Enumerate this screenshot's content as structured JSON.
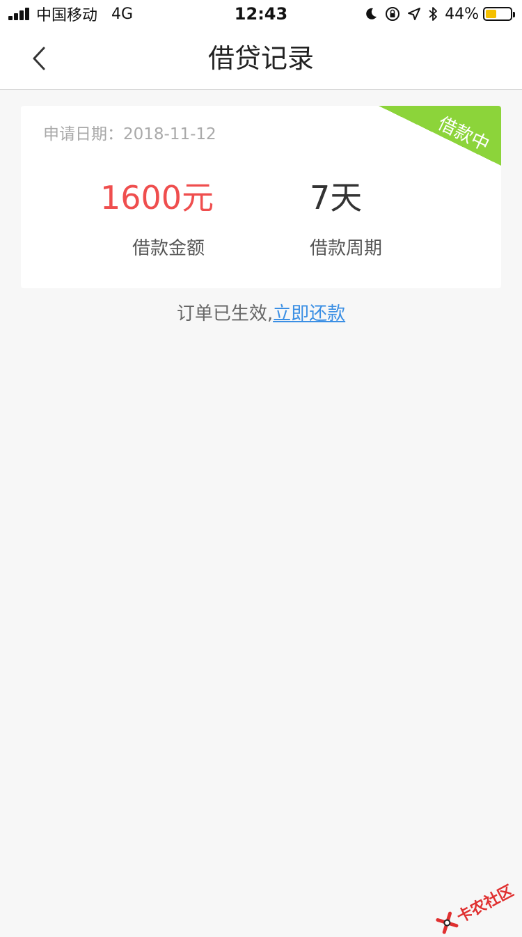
{
  "status_bar": {
    "carrier": "中国移动",
    "network": "4G",
    "time": "12:43",
    "battery_percent": "44%",
    "battery_level": 0.44,
    "battery_color": "#f5c000",
    "icons": [
      "moon-icon",
      "orientation-lock-icon",
      "location-icon",
      "bluetooth-icon"
    ]
  },
  "header": {
    "title": "借贷记录",
    "back_icon": "chevron-left-icon"
  },
  "loan_card": {
    "apply_date": "申请日期：2018-11-12",
    "status_badge": "借款中",
    "status_color": "#8cd43a",
    "amount_value": "1600元",
    "amount_color": "#ef4e4e",
    "amount_label": "借款金额",
    "period_value": "7天",
    "period_label": "借款周期"
  },
  "notice": {
    "text": "订单已生效,",
    "link": "立即还款",
    "link_color": "#3b8fe4"
  },
  "watermark": {
    "text": "卡农社区"
  }
}
